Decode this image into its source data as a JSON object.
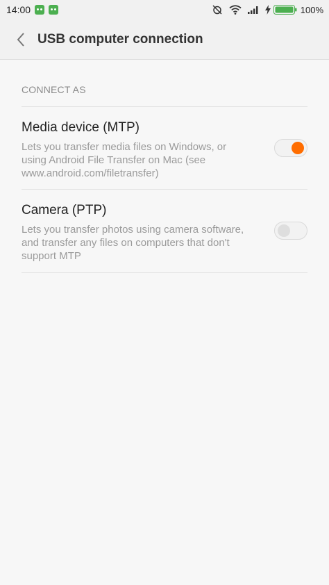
{
  "status_bar": {
    "time": "14:00",
    "battery_percent": "100%",
    "notification_icons": [
      "app-notification-icon",
      "app-notification-icon"
    ],
    "system_icons": [
      "alarm-off-icon",
      "wifi-icon",
      "signal-icon",
      "charging-icon",
      "battery-icon"
    ]
  },
  "header": {
    "title": "USB computer connection",
    "back_icon": "chevron-left-icon"
  },
  "section": {
    "title": "CONNECT AS"
  },
  "options": [
    {
      "title": "Media device (MTP)",
      "description": "Lets you transfer media files on Windows, or using Android File Transfer on Mac (see www.android.com/filetransfer)",
      "enabled": true
    },
    {
      "title": "Camera (PTP)",
      "description": "Lets you transfer photos using camera software, and transfer any files on computers that don't support MTP",
      "enabled": false
    }
  ],
  "colors": {
    "accent": "#ff6d00",
    "battery": "#4caf50"
  }
}
